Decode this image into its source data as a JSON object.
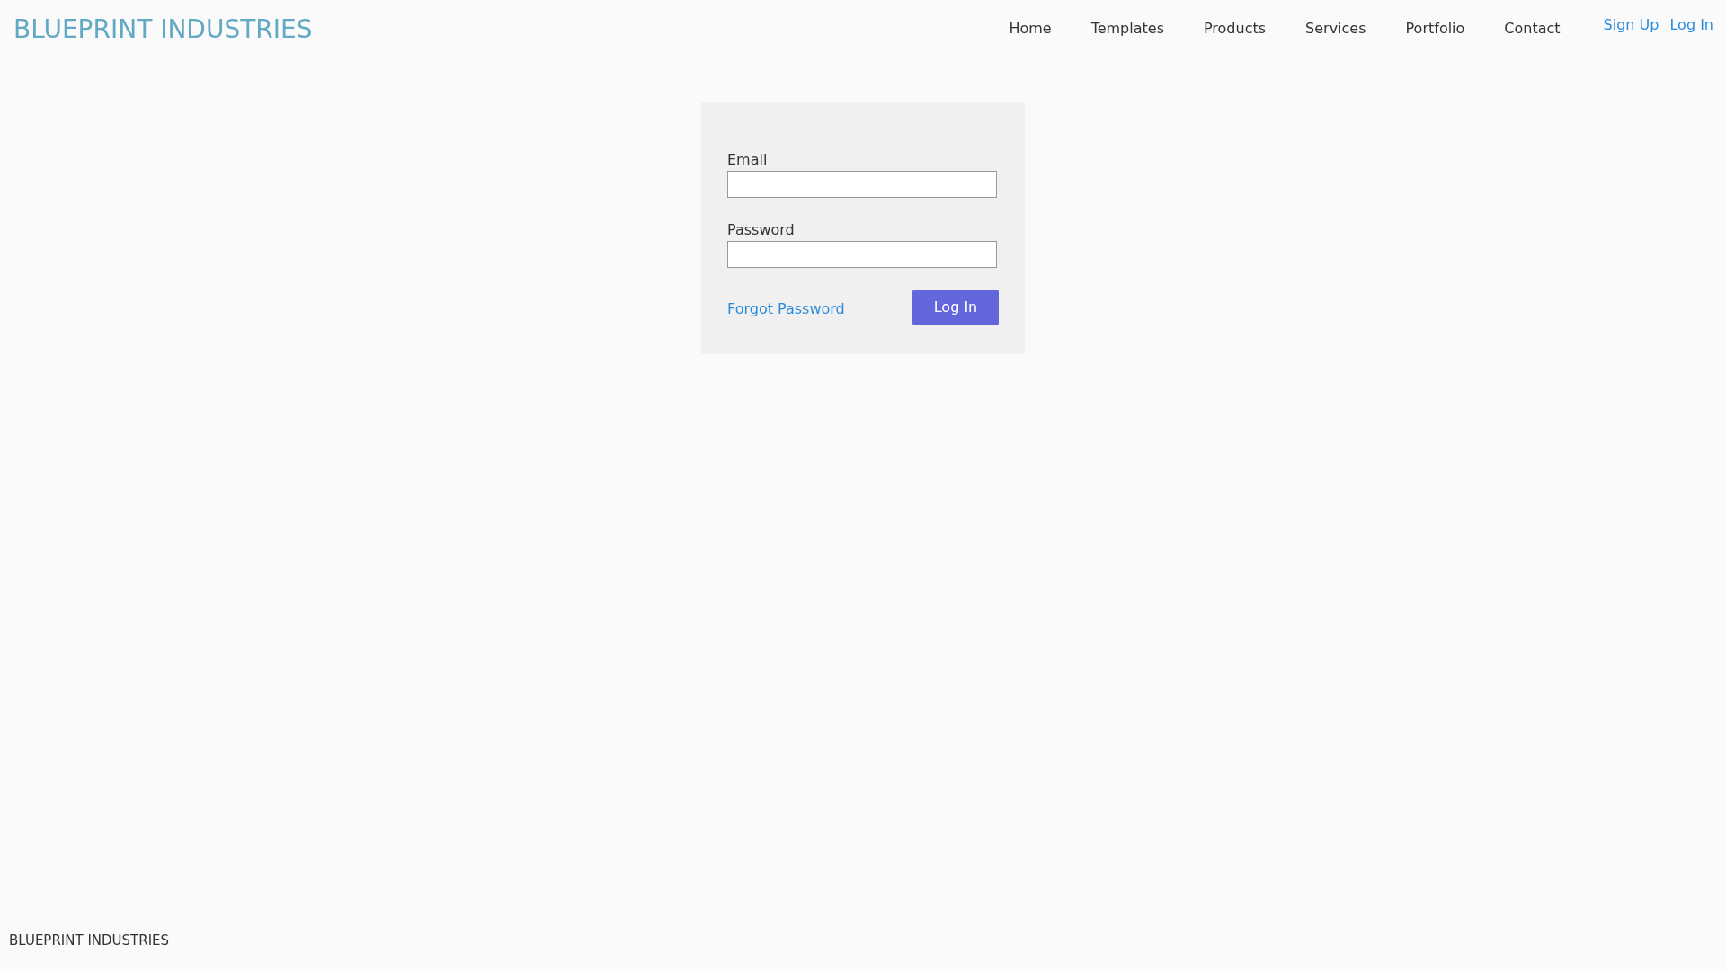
{
  "header": {
    "brand": "BLUEPRINT INDUSTRIES",
    "nav": [
      "Home",
      "Templates",
      "Products",
      "Services",
      "Portfolio",
      "Contact"
    ],
    "auth_links": [
      "Sign Up",
      "Log In"
    ]
  },
  "login_form": {
    "fields": [
      {
        "label": "Email"
      },
      {
        "label": "Password"
      }
    ],
    "forgot_link": "Forgot Password",
    "submit": "Log In"
  },
  "footer": {
    "text": "BLUEPRINT INDUSTRIES"
  }
}
